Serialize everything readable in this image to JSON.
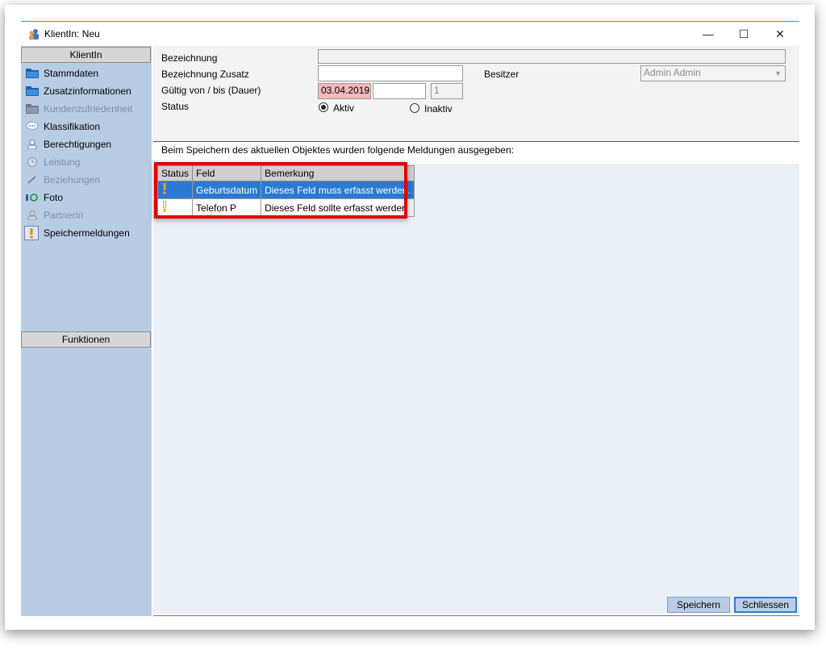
{
  "window": {
    "title": "KlientIn: Neu",
    "minimize": "—",
    "maximize": "☐",
    "close": "✕"
  },
  "sidebar": {
    "section_title": "KlientIn",
    "items": [
      {
        "label": "Stammdaten",
        "icon": "folder-icon",
        "enabled": true
      },
      {
        "label": "Zusatzinformationen",
        "icon": "folder-icon",
        "enabled": true
      },
      {
        "label": "Kundenzufriedenheit",
        "icon": "folder-icon",
        "enabled": false
      },
      {
        "label": "Klassifikation",
        "icon": "speech-bubble-icon",
        "enabled": true
      },
      {
        "label": "Berechtigungen",
        "icon": "user-icon",
        "enabled": true
      },
      {
        "label": "Leistung",
        "icon": "clock-icon",
        "enabled": false
      },
      {
        "label": "Beziehungen",
        "icon": "pencil-icon",
        "enabled": false
      },
      {
        "label": "Foto",
        "icon": "camera-icon",
        "enabled": true
      },
      {
        "label": "PartnerIn",
        "icon": "user-icon",
        "enabled": false
      },
      {
        "label": "Speichermeldungen",
        "icon": "warning-icon",
        "enabled": true
      }
    ],
    "functions_title": "Funktionen"
  },
  "form": {
    "bezeichnung_label": "Bezeichnung",
    "bezeichnung_value": "",
    "zusatz_label": "Bezeichnung Zusatz",
    "zusatz_value": "",
    "besitzer_label": "Besitzer",
    "besitzer_value": "Admin Admin",
    "gueltig_label": "Gültig von / bis (Dauer)",
    "gueltig_von": "03.04.2019",
    "gueltig_bis": "",
    "dauer": "1",
    "status_label": "Status",
    "status_aktiv": "Aktiv",
    "status_inaktiv": "Inaktiv",
    "status_selected": "Aktiv"
  },
  "message": "Beim Speichern des aktuellen Objektes wurden folgende Meldungen ausgegeben:",
  "grid": {
    "columns": [
      "Status",
      "Feld",
      "Bemerkung"
    ],
    "rows": [
      {
        "status_icon": "warning-icon",
        "feld": "Geburtsdatum",
        "bemerkung": "Dieses Feld muss erfasst werden."
      },
      {
        "status_icon": "warning-icon",
        "feld": "Telefon P",
        "bemerkung": "Dieses Feld sollte erfasst werden"
      }
    ]
  },
  "buttons": {
    "save": "Speichern",
    "close": "Schliessen"
  },
  "colors": {
    "sidebar_bg": "#b8cde4",
    "selection": "#2b79d0",
    "highlight_frame": "#e00000",
    "date_error_bg": "#f4b9b9"
  }
}
